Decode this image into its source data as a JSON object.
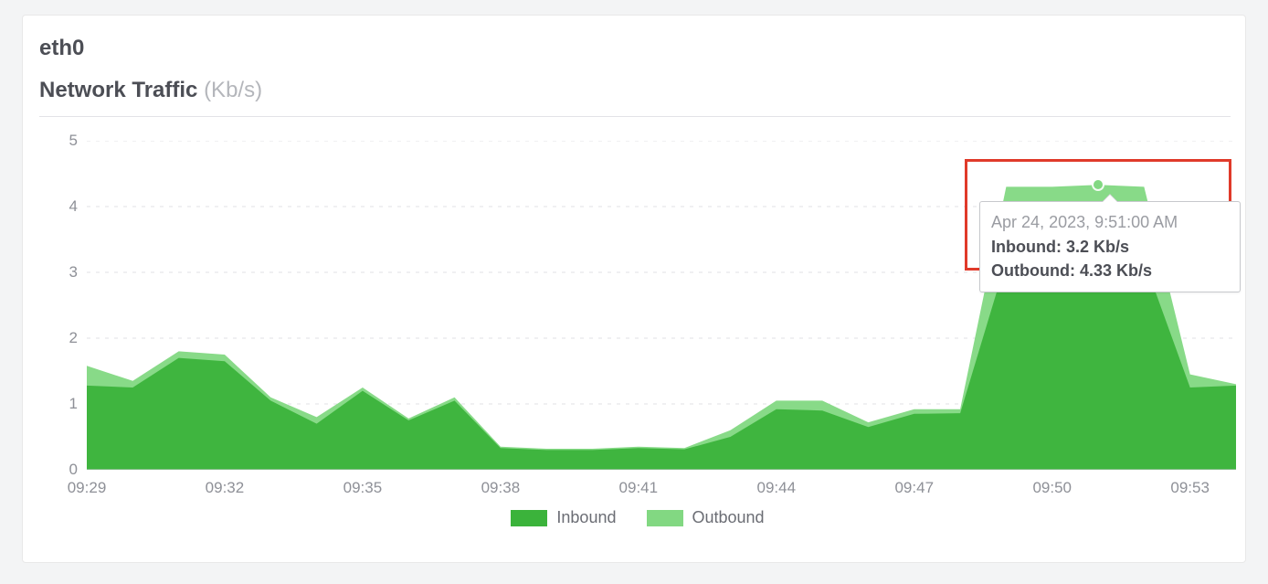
{
  "interface_title": "eth0",
  "chart": {
    "title": "Network Traffic",
    "unit_label": "(Kb/s)"
  },
  "legend": {
    "inbound": "Inbound",
    "outbound": "Outbound"
  },
  "tooltip": {
    "timestamp": "Apr 24, 2023, 9:51:00 AM",
    "inbound_label": "Inbound:",
    "inbound_value": "3.2 Kb/s",
    "outbound_label": "Outbound:",
    "outbound_value": "4.33 Kb/s"
  },
  "colors": {
    "inbound": "#3bb33b",
    "outbound": "#82d882",
    "grid": "#e1e2e6",
    "axis_text": "#8e9097",
    "highlight": "#e03a2a"
  },
  "chart_data": {
    "type": "area",
    "title": "Network Traffic (Kb/s)",
    "xlabel": "",
    "ylabel": "",
    "ylim": [
      0,
      5
    ],
    "x_ticks": [
      "09:29",
      "09:32",
      "09:35",
      "09:38",
      "09:41",
      "09:44",
      "09:47",
      "09:50",
      "09:53"
    ],
    "categories": [
      "09:29",
      "09:30",
      "09:31",
      "09:32",
      "09:33",
      "09:34",
      "09:35",
      "09:36",
      "09:37",
      "09:38",
      "09:39",
      "09:40",
      "09:41",
      "09:42",
      "09:43",
      "09:44",
      "09:45",
      "09:46",
      "09:47",
      "09:48",
      "09:49",
      "09:50",
      "09:51",
      "09:52",
      "09:53",
      "09:54"
    ],
    "series": [
      {
        "name": "Outbound",
        "color": "#82d882",
        "values": [
          1.58,
          1.35,
          1.8,
          1.75,
          1.1,
          0.8,
          1.25,
          0.78,
          1.1,
          0.35,
          0.32,
          0.32,
          0.35,
          0.33,
          0.6,
          1.05,
          1.05,
          0.72,
          0.92,
          0.92,
          4.3,
          4.3,
          4.33,
          4.3,
          1.45,
          1.3
        ]
      },
      {
        "name": "Inbound",
        "color": "#3bb33b",
        "values": [
          1.28,
          1.25,
          1.7,
          1.65,
          1.05,
          0.7,
          1.2,
          0.75,
          1.05,
          0.33,
          0.3,
          0.3,
          0.33,
          0.31,
          0.5,
          0.92,
          0.9,
          0.65,
          0.85,
          0.86,
          3.18,
          3.16,
          3.2,
          3.18,
          1.25,
          1.28
        ]
      }
    ],
    "annotations": {
      "tooltip_index": 22,
      "tooltip_time": "09:51",
      "tooltip_values": {
        "Inbound": 3.2,
        "Outbound": 4.33
      }
    },
    "legend_position": "bottom",
    "grid": true
  }
}
